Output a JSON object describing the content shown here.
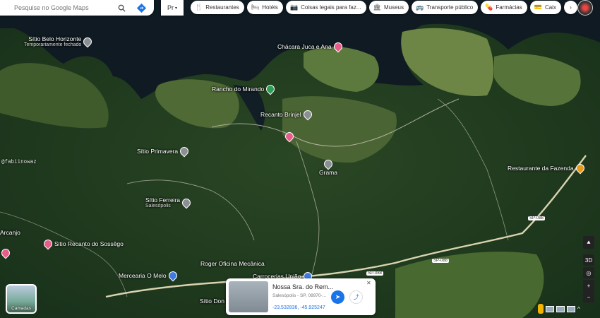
{
  "search": {
    "placeholder": "Pesquise no Google Maps"
  },
  "places_button": {
    "label": "Pr"
  },
  "chips": [
    {
      "icon": "restaurant-icon",
      "glyph": "🍴",
      "label": "Restaurantes"
    },
    {
      "icon": "hotel-icon",
      "glyph": "🛏",
      "label": "Hotéis"
    },
    {
      "icon": "camera-icon",
      "glyph": "📷",
      "label": "Coisas legais para faz..."
    },
    {
      "icon": "museum-icon",
      "glyph": "🏛",
      "label": "Museus"
    },
    {
      "icon": "transit-icon",
      "glyph": "🚌",
      "label": "Transporte público"
    },
    {
      "icon": "pharmacy-icon",
      "glyph": "💊",
      "label": "Farmácias"
    },
    {
      "icon": "atm-icon",
      "glyph": "💳",
      "label": "Caix"
    }
  ],
  "pois": {
    "sitio_belo_horizonte": {
      "name": "Sítio Belo Horizonte",
      "status": "Temporariamente fechado"
    },
    "chacara_juca_ana": {
      "name": "Chácara Juca e Ana"
    },
    "rancho_mirando": {
      "name": "Rancho do Mirando"
    },
    "recanto_brinjel": {
      "name": "Recanto Brinjel"
    },
    "grama": {
      "name": "Grama"
    },
    "sitio_primavera": {
      "name": "Sítio Primavera"
    },
    "restaurante_fazenda": {
      "name": "Restaurante da Fazenda"
    },
    "sitio_ferreira": {
      "name": "Sítio Ferreira",
      "sub": "Salesópolis"
    },
    "arcanjo": {
      "name": "Arcanjo"
    },
    "sitio_recanto_sossego": {
      "name": "Sitio Recanto do Sossêgo"
    },
    "mercearia": {
      "name": "Mercearia O Melo"
    },
    "roger_oficina": {
      "name": "Roger Oficina Mecânica"
    },
    "carrocerias": {
      "name": "Carrocerias União"
    },
    "sitio_don": {
      "name": "Sítio Don R..."
    }
  },
  "roads": [
    "SP-088",
    "SP-088",
    "SP-088"
  ],
  "watermark": "@fabiinowaz",
  "layers_button": {
    "label": "Camadas"
  },
  "map_controls": {
    "label_3d": "3D",
    "zoom_in": "+",
    "zoom_out": "−"
  },
  "place_card": {
    "title": "Nossa Sra. do Rem...",
    "subtitle": "Salesópolis - SP, 08970-...",
    "coordinates": "-23.532836, -45.925247"
  },
  "colors": {
    "water": "#0f1a22",
    "forest": "#1f3a1c",
    "field": "#5f7a3c",
    "accent": "#1a73e8"
  }
}
